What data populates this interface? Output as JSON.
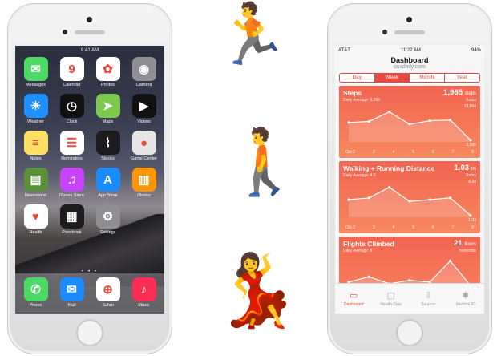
{
  "left_phone": {
    "status": {
      "carrier": "",
      "time": "9:41 AM",
      "battery": ""
    },
    "apps": [
      {
        "label": "Messages",
        "icon": "messages-icon",
        "color": "#4cd964",
        "glyph": "✉"
      },
      {
        "label": "Calendar",
        "icon": "calendar-icon",
        "color": "#ffffff",
        "glyph": "9"
      },
      {
        "label": "Photos",
        "icon": "photos-icon",
        "color": "#ffffff",
        "glyph": "✿"
      },
      {
        "label": "Camera",
        "icon": "camera-icon",
        "color": "#8e8e93",
        "glyph": "◉"
      },
      {
        "label": "Weather",
        "icon": "weather-icon",
        "color": "#1e90ff",
        "glyph": "☀"
      },
      {
        "label": "Clock",
        "icon": "clock-icon",
        "color": "#111111",
        "glyph": "◷"
      },
      {
        "label": "Maps",
        "icon": "maps-icon",
        "color": "#7ec850",
        "glyph": "➤"
      },
      {
        "label": "Videos",
        "icon": "videos-icon",
        "color": "#111111",
        "glyph": "▶"
      },
      {
        "label": "Notes",
        "icon": "notes-icon",
        "color": "#ffe066",
        "glyph": "≡"
      },
      {
        "label": "Reminders",
        "icon": "reminders-icon",
        "color": "#ffffff",
        "glyph": "☰"
      },
      {
        "label": "Stocks",
        "icon": "stocks-icon",
        "color": "#1c1c1e",
        "glyph": "⌇"
      },
      {
        "label": "Game Center",
        "icon": "game-center-icon",
        "color": "#e6e6e6",
        "glyph": "●"
      },
      {
        "label": "Newsstand",
        "icon": "newsstand-icon",
        "color": "#5b8f3a",
        "glyph": "▤"
      },
      {
        "label": "iTunes Store",
        "icon": "itunes-store-icon",
        "color": "#c644fc",
        "glyph": "♫"
      },
      {
        "label": "App Store",
        "icon": "app-store-icon",
        "color": "#1a8cff",
        "glyph": "A"
      },
      {
        "label": "iBooks",
        "icon": "ibooks-icon",
        "color": "#ff9500",
        "glyph": "▥"
      },
      {
        "label": "Health",
        "icon": "health-icon",
        "color": "#ffffff",
        "glyph": "♥"
      },
      {
        "label": "Passbook",
        "icon": "passbook-icon",
        "color": "#1c1c1e",
        "glyph": "▦"
      },
      {
        "label": "Settings",
        "icon": "settings-icon",
        "color": "#8e8e93",
        "glyph": "⚙"
      }
    ],
    "page_dots": "• • •",
    "dock": [
      {
        "label": "Phone",
        "icon": "phone-icon",
        "color": "#4cd964",
        "glyph": "✆"
      },
      {
        "label": "Mail",
        "icon": "mail-icon",
        "color": "#1a8cff",
        "glyph": "✉"
      },
      {
        "label": "Safari",
        "icon": "safari-icon",
        "color": "#ffffff",
        "glyph": "⊕"
      },
      {
        "label": "Music",
        "icon": "music-icon",
        "color": "#ff2d55",
        "glyph": "♪"
      }
    ]
  },
  "right_phone": {
    "status": {
      "carrier": "AT&T",
      "time": "11:22 AM",
      "battery": "94%"
    },
    "title": "Dashboard",
    "subtitle": "osxdaily.com",
    "segments": [
      "Day",
      "Week",
      "Month",
      "Year"
    ],
    "active_segment": "Week",
    "cards": [
      {
        "title": "Steps",
        "average": "Daily Average: 9,254",
        "value": "1,965",
        "unit": "steps",
        "when": "Today",
        "max": "13,804",
        "min": "1,965",
        "ticks": [
          "Oct 2",
          "3",
          "4",
          "5",
          "6",
          "7",
          "8"
        ],
        "values": [
          0.55,
          0.58,
          0.85,
          0.5,
          0.6,
          0.62,
          0.05
        ]
      },
      {
        "title": "Walking + Running Distance",
        "average": "Daily Average: 4.9",
        "value": "1.03",
        "unit": "mi",
        "when": "Today",
        "max": "8.28",
        "min": "1.03",
        "ticks": [
          "Oct 2",
          "3",
          "4",
          "5",
          "6",
          "7",
          "8"
        ],
        "values": [
          0.5,
          0.55,
          0.85,
          0.45,
          0.5,
          0.55,
          0.05
        ]
      },
      {
        "title": "Flights Climbed",
        "average": "Daily Average: 8",
        "value": "21",
        "unit": "floors",
        "when": "Yesterday",
        "max": "",
        "min": "",
        "ticks": [
          "",
          "",
          "",
          "",
          "",
          "",
          ""
        ],
        "values": [
          0.3,
          0.45,
          0.25,
          0.35,
          0.3,
          0.9,
          0.2
        ]
      }
    ],
    "tabs": [
      {
        "label": "Dashboard",
        "icon": "dashboard-icon",
        "glyph": "▭",
        "active": true
      },
      {
        "label": "Health Data",
        "icon": "health-data-icon",
        "glyph": "▢",
        "active": false
      },
      {
        "label": "Sources",
        "icon": "sources-icon",
        "glyph": "⇩",
        "active": false
      },
      {
        "label": "Medical ID",
        "icon": "medical-id-icon",
        "glyph": "✱",
        "active": false
      }
    ]
  },
  "emoji": [
    {
      "name": "running-man-emoji",
      "glyph": "🏃"
    },
    {
      "name": "walking-man-emoji",
      "glyph": "🚶"
    },
    {
      "name": "dancing-woman-emoji",
      "glyph": "💃"
    }
  ]
}
